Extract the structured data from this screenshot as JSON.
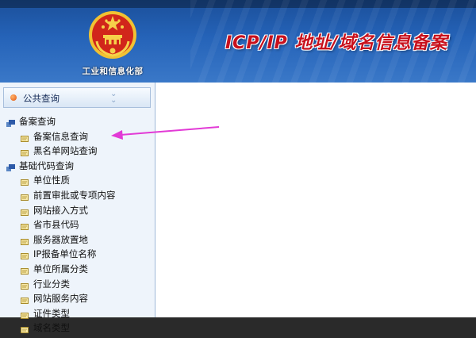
{
  "header": {
    "ministry_name": "工业和信息化部",
    "site_title": "ICP/IP 地址/域名信息备案"
  },
  "sidebar": {
    "panel_title": "公共查询",
    "categories": [
      {
        "label": "备案查询",
        "items": [
          "备案信息查询",
          "黑名单网站查询"
        ]
      },
      {
        "label": "基础代码查询",
        "items": [
          "单位性质",
          "前置审批或专项内容",
          "网站接入方式",
          "省市县代码",
          "服务器放置地",
          "IP报备单位名称",
          "单位所属分类",
          "行业分类",
          "网站服务内容",
          "证件类型",
          "域名类型"
        ]
      }
    ]
  },
  "colors": {
    "header_blue": "#2563b8",
    "title_red": "#c8101c",
    "arrow_magenta": "#e23ad6",
    "sidebar_bg": "#eef4fb"
  }
}
